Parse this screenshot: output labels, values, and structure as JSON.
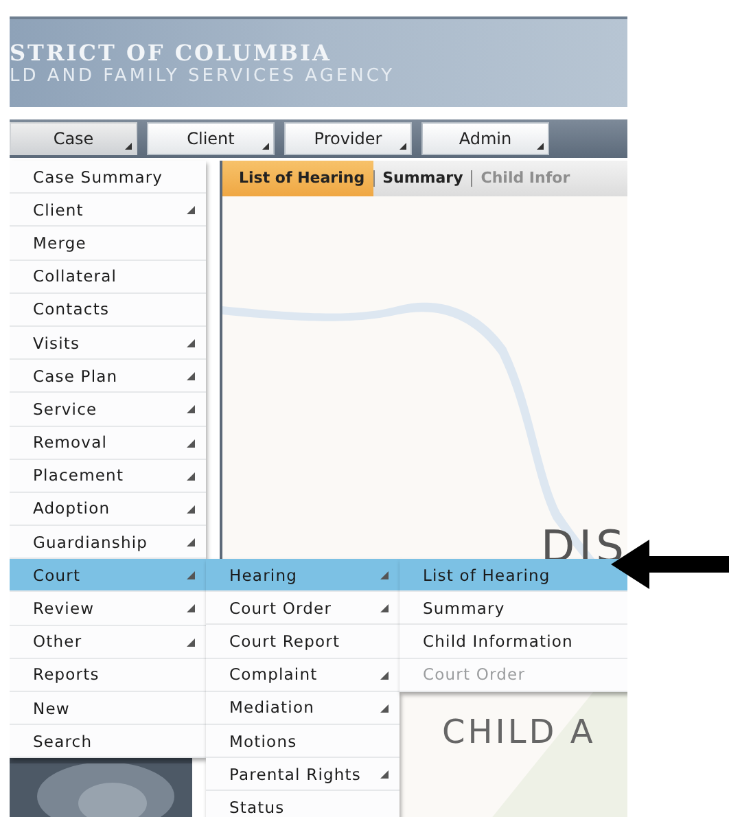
{
  "header": {
    "title": "STRICT OF COLUMBIA",
    "subtitle": "LD AND FAMILY SERVICES AGENCY"
  },
  "nav": [
    {
      "label": "Case",
      "selected": true
    },
    {
      "label": "Client",
      "selected": false
    },
    {
      "label": "Provider",
      "selected": false
    },
    {
      "label": "Admin",
      "selected": false
    }
  ],
  "tabs": [
    {
      "label": "List of Hearing",
      "selected": true,
      "disabled": false
    },
    {
      "label": "Summary",
      "selected": false,
      "disabled": false
    },
    {
      "label": "Child Infor",
      "selected": false,
      "disabled": true
    }
  ],
  "banner_texts": [
    "DIS",
    "CHILD A"
  ],
  "menu": [
    {
      "label": "Case Summary",
      "submenu": false,
      "selected": false
    },
    {
      "label": "Client",
      "submenu": true,
      "selected": false
    },
    {
      "label": "Merge",
      "submenu": false,
      "selected": false
    },
    {
      "label": "Collateral",
      "submenu": false,
      "selected": false
    },
    {
      "label": "Contacts",
      "submenu": false,
      "selected": false
    },
    {
      "label": "Visits",
      "submenu": true,
      "selected": false
    },
    {
      "label": "Case Plan",
      "submenu": true,
      "selected": false
    },
    {
      "label": "Service",
      "submenu": true,
      "selected": false
    },
    {
      "label": "Removal",
      "submenu": true,
      "selected": false
    },
    {
      "label": "Placement",
      "submenu": true,
      "selected": false
    },
    {
      "label": "Adoption",
      "submenu": true,
      "selected": false
    },
    {
      "label": "Guardianship",
      "submenu": true,
      "selected": false
    },
    {
      "label": "Court",
      "submenu": true,
      "selected": true
    },
    {
      "label": "Review",
      "submenu": true,
      "selected": false
    },
    {
      "label": "Other",
      "submenu": true,
      "selected": false
    },
    {
      "label": "Reports",
      "submenu": false,
      "selected": false
    },
    {
      "label": "New",
      "submenu": false,
      "selected": false
    },
    {
      "label": "Search",
      "submenu": false,
      "selected": false
    }
  ],
  "submenu": [
    {
      "label": "Hearing",
      "submenu": true,
      "selected": true
    },
    {
      "label": "Court Order",
      "submenu": true,
      "selected": false
    },
    {
      "label": "Court Report",
      "submenu": false,
      "selected": false
    },
    {
      "label": "Complaint",
      "submenu": true,
      "selected": false
    },
    {
      "label": "Mediation",
      "submenu": true,
      "selected": false
    },
    {
      "label": "Motions",
      "submenu": false,
      "selected": false
    },
    {
      "label": "Parental Rights",
      "submenu": true,
      "selected": false
    },
    {
      "label": "Status",
      "submenu": false,
      "selected": false
    }
  ],
  "hearing_submenu": [
    {
      "label": "List of Hearing",
      "selected": true,
      "disabled": false
    },
    {
      "label": "Summary",
      "selected": false,
      "disabled": false
    },
    {
      "label": "Child Information",
      "selected": false,
      "disabled": false
    },
    {
      "label": "Court Order",
      "selected": false,
      "disabled": true
    }
  ]
}
